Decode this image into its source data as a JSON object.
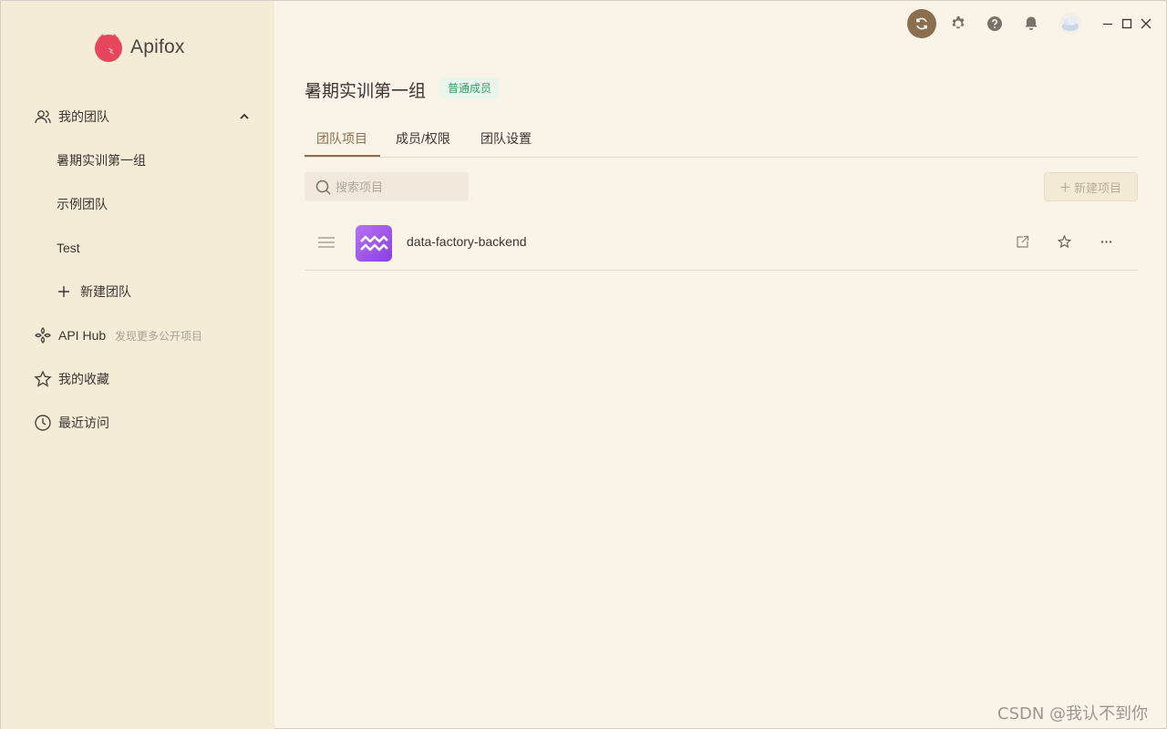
{
  "app": {
    "name": "Apifox",
    "brand_color": "#e6455c",
    "accent_color": "#8b6e4e"
  },
  "sidebar": {
    "my_team": "我的团队",
    "teams": [
      "暑期实训第一组",
      "示例团队",
      "Test"
    ],
    "new_team": "新建团队",
    "api_hub": "API Hub",
    "api_hub_hint": "发现更多公开项目",
    "favorites": "我的收藏",
    "recent": "最近访问"
  },
  "titlebar": {
    "icons": [
      "sync-icon",
      "gear-icon",
      "help-icon",
      "bell-icon",
      "avatar",
      "minimize-icon",
      "maximize-icon",
      "close-icon"
    ]
  },
  "main": {
    "team_name": "暑期实训第一组",
    "role": "普通成员",
    "tabs": [
      {
        "label": "团队项目",
        "active": true
      },
      {
        "label": "成员/权限",
        "active": false
      },
      {
        "label": "团队设置",
        "active": false
      }
    ],
    "search_placeholder": "搜索项目",
    "new_project_label": "新建项目",
    "projects": [
      {
        "name": "data-factory-backend",
        "icon_color": "#9b55e8"
      }
    ]
  },
  "watermark": "CSDN @我认不到你"
}
